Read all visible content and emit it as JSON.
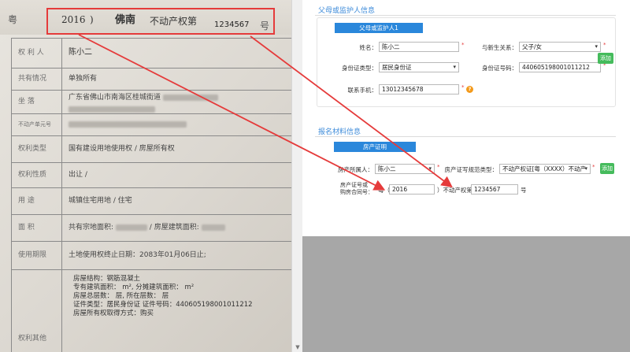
{
  "certificate": {
    "header": {
      "prefix": "粤",
      "year": "2016",
      "paren": ")",
      "city": "佛南",
      "type": "不动产权第",
      "number": "1234567",
      "suffix": "号"
    },
    "rows": [
      {
        "label": "权 利 人",
        "value": "陈小二"
      },
      {
        "label": "共有情况",
        "value": "单独所有"
      },
      {
        "label": "坐    落",
        "value": "广东省佛山市南海区桂城街道"
      },
      {
        "label": "不动产单元号",
        "value": ""
      },
      {
        "label": "权利类型",
        "value": "国有建设用地使用权 / 房屋所有权"
      },
      {
        "label": "权利性质",
        "value": "出让 /"
      },
      {
        "label": "用    途",
        "value": "城镇住宅用地 / 住宅"
      },
      {
        "label": "面    积",
        "value": "共有宗地面积:",
        "value2": "/ 房屋建筑面积:"
      },
      {
        "label": "使用期限",
        "value": "土地使用权终止日期：2083年01月06日止;"
      },
      {
        "label": "权利其他",
        "value": ""
      }
    ],
    "notes": [
      "房屋结构：钢筋混凝土",
      "专有建筑面积：        m², 分摊建筑面积：      m²",
      "房屋总层数：       层, 所在层数：    层",
      "证件类型：居民身份证    证件号码：440605198001011212",
      "房屋所有权取得方式：购买"
    ]
  },
  "form": {
    "guardian_section": {
      "title": "父母或监护人信息",
      "tab": "父母或监护人1",
      "name_label": "姓名：",
      "name_value": "陈小二",
      "relation_label": "与新生关系：",
      "relation_value": "父子/女",
      "idtype_label": "身份证类型：",
      "idtype_value": "居民身份证",
      "idno_label": "身份证号码：",
      "idno_value": "440605198001011212",
      "phone_label": "联系手机：",
      "phone_value": "13012345678",
      "add_label": "添加"
    },
    "material_section": {
      "title": "报名材料信息",
      "tab": "房产证明",
      "owner_label": "房产所属人：",
      "owner_value": "陈小二",
      "certtype_label": "房产证写规范类型：",
      "certtype_value": "不动产权证[粤（XXXX）不动产",
      "add_label": "添加",
      "certno_label_1": "房产证号或",
      "certno_label_2": "购房合同号：",
      "prefix": "粤（",
      "year_value": "2016",
      "middle": "）不动产权第",
      "number_value": "1234567",
      "suffix": "号"
    }
  },
  "colors": {
    "accent": "#2a87db",
    "highlight": "#e53b3b",
    "add": "#45bb5c",
    "help": "#f39a1b"
  }
}
